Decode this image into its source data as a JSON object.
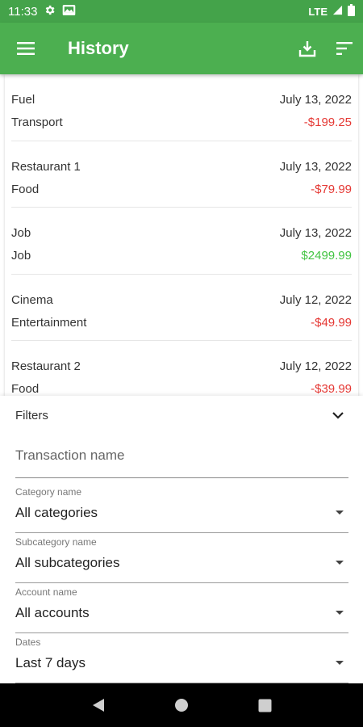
{
  "status_bar": {
    "time": "11:33",
    "network": "LTE"
  },
  "app_bar": {
    "title": "History"
  },
  "transactions": [
    {
      "name": "Fuel",
      "date": "July 13, 2022",
      "category": "Transport",
      "amount": "-$199.25",
      "type": "expense"
    },
    {
      "name": "Restaurant 1",
      "date": "July 13, 2022",
      "category": "Food",
      "amount": "-$79.99",
      "type": "expense"
    },
    {
      "name": "Job",
      "date": "July 13, 2022",
      "category": "Job",
      "amount": "$2499.99",
      "type": "income"
    },
    {
      "name": "Cinema",
      "date": "July 12, 2022",
      "category": "Entertainment",
      "amount": "-$49.99",
      "type": "expense"
    },
    {
      "name": "Restaurant 2",
      "date": "July 12, 2022",
      "category": "Food",
      "amount": "-$39.99",
      "type": "expense"
    }
  ],
  "filters": {
    "title": "Filters",
    "transaction_name_placeholder": "Transaction name",
    "category": {
      "label": "Category name",
      "value": "All categories"
    },
    "subcategory": {
      "label": "Subcategory name",
      "value": "All subcategories"
    },
    "account": {
      "label": "Account name",
      "value": "All accounts"
    },
    "dates": {
      "label": "Dates",
      "value": "Last 7 days"
    }
  },
  "colors": {
    "status_bar": "#44a34a",
    "app_bar": "#4caf50",
    "expense": "#e53935",
    "income": "#43c443"
  },
  "icons": [
    "settings-icon",
    "sim-card-icon",
    "lte-signal-icon",
    "battery-icon",
    "menu-icon",
    "download-icon",
    "sort-icon",
    "chevron-down-icon",
    "back-icon",
    "home-icon",
    "recents-icon"
  ]
}
